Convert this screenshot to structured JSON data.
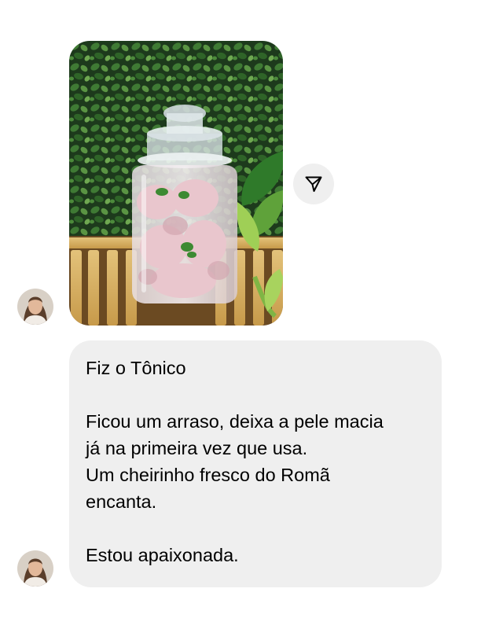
{
  "thread": {
    "photo_message": {
      "image_name": "jar-of-tonic-photo",
      "share_icon": "paper-plane-icon"
    },
    "text_message": {
      "lines": [
        "Fiz o Tônico",
        "",
        "Ficou um arraso, deixa a pele macia",
        "já na primeira vez que usa.",
        "Um cheirinho fresco do Romã",
        "encanta.",
        "",
        "Estou apaixonada."
      ]
    }
  },
  "colors": {
    "bubble_background": "#efefef",
    "share_button_background": "#efefef",
    "text": "#000000",
    "background": "#ffffff"
  }
}
